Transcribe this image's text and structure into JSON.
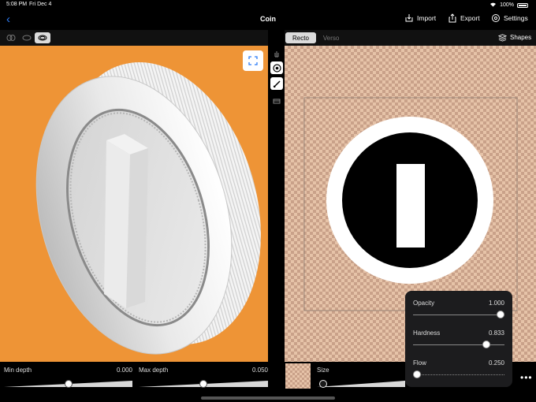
{
  "status": {
    "time": "5:08 PM",
    "date": "Fri Dec 4",
    "battery": "100%"
  },
  "nav": {
    "title": "Coin",
    "import_label": "Import",
    "export_label": "Export",
    "settings_label": "Settings"
  },
  "texture_tabs": {
    "recto": "Recto",
    "verso": "Verso",
    "shapes_label": "Shapes"
  },
  "bottom": {
    "min_depth": {
      "label": "Min depth",
      "value": "0.000",
      "fraction": 0.5
    },
    "max_depth": {
      "label": "Max depth",
      "value": "0.050",
      "fraction": 0.5
    },
    "size": {
      "label": "Size"
    }
  },
  "brush_popover": {
    "opacity": {
      "label": "Opacity",
      "value": "1.000",
      "fraction": 1.0
    },
    "hardness": {
      "label": "Hardness",
      "value": "0.833",
      "fraction": 0.833
    },
    "flow": {
      "label": "Flow",
      "value": "0.250",
      "fraction": 0.0
    }
  },
  "colors": {
    "accent": "#2d7cf6",
    "viewport_bg": "#ee9436"
  }
}
